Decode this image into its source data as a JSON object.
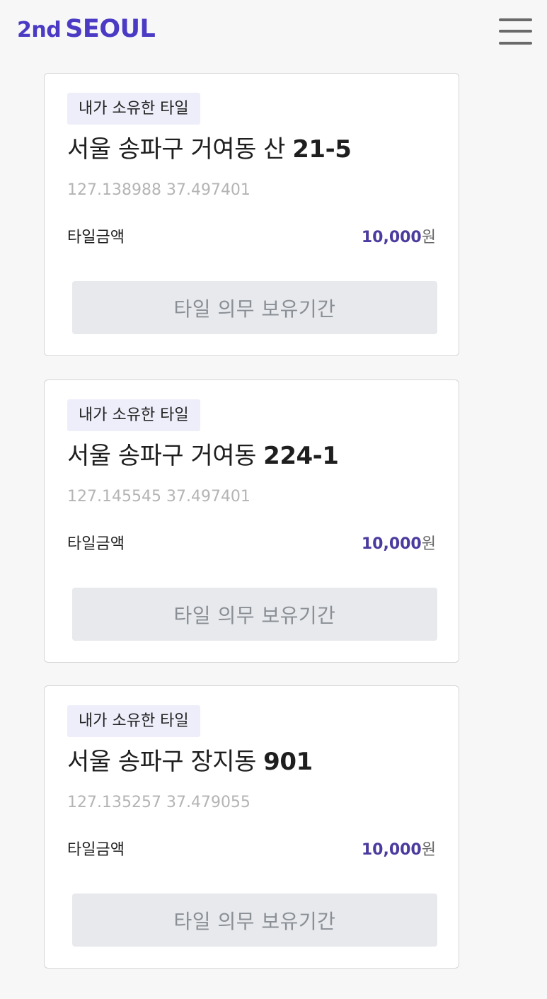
{
  "header": {
    "logo_prefix": "2nd",
    "logo_main": "SEOUL",
    "brand_color": "#4b3bc4"
  },
  "tiles": [
    {
      "badge": "내가 소유한 타일",
      "address": "서울 송파구 거여동 산",
      "lot": "21-5",
      "coordinates": "127.138988 37.497401",
      "amount_label": "타일금액",
      "amount": "10,000",
      "currency": "원",
      "button_label": "타일 의무 보유기간"
    },
    {
      "badge": "내가 소유한 타일",
      "address": "서울 송파구 거여동",
      "lot": "224-1",
      "coordinates": "127.145545 37.497401",
      "amount_label": "타일금액",
      "amount": "10,000",
      "currency": "원",
      "button_label": "타일 의무 보유기간"
    },
    {
      "badge": "내가 소유한 타일",
      "address": "서울 송파구 장지동",
      "lot": "901",
      "coordinates": "127.135257 37.479055",
      "amount_label": "타일금액",
      "amount": "10,000",
      "currency": "원",
      "button_label": "타일 의무 보유기간"
    }
  ],
  "colors": {
    "accent": "#4b3b9e",
    "badge_bg": "#eeeefb",
    "button_bg": "#e7e9ec"
  }
}
